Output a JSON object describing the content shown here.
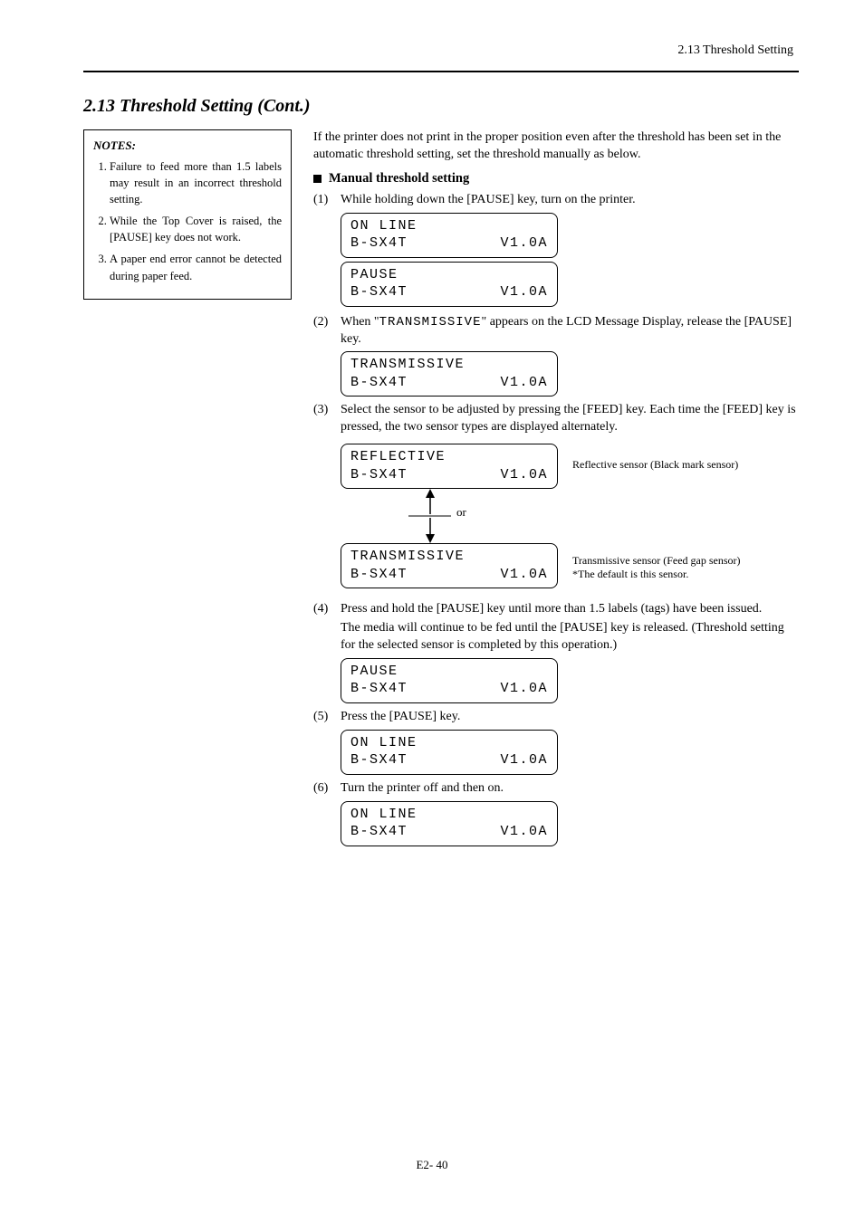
{
  "header": {
    "right": "2.13 Threshold Setting"
  },
  "section": {
    "number": "2.13",
    "title": "Threshold Setting (Cont.)"
  },
  "notes": {
    "heading": "NOTES:",
    "items": [
      "Failure to feed more than 1.5 labels may result in an incorrect threshold setting.",
      "While the Top Cover is raised, the [PAUSE] key does not work.",
      "A paper end error cannot be detected during paper feed."
    ]
  },
  "intro": "If the printer does not print in the proper position even after the threshold has been set in the automatic threshold setting, set the threshold manually as below.",
  "sub_heading": "Manual threshold setting",
  "steps": {
    "s1": "While holding down the [PAUSE] key, turn on the printer.",
    "s2": {
      "a": "When \"",
      "val": "TRANSMISSIVE",
      "b": "\" appears on the LCD Message Display, release the [PAUSE] key."
    },
    "s3": {
      "a": "Select the sensor to be adjusted by pressing the [FEED] key. ",
      "b": "Each time the [FEED] key is pressed, the two sensor types are displayed alternately."
    },
    "s3_ref": "Reflective sensor (Black mark sensor)",
    "s3_trn_note_a": "Transmissive sensor (Feed gap sensor)",
    "s3_trn_note_b": "*The default is this sensor.",
    "s4": "Press and hold the [PAUSE] key until more than 1.5 labels (tags) have been issued.",
    "s4b": "The media will continue to be fed until the [PAUSE] key is released. (Threshold setting for the selected sensor is completed by this operation.)",
    "s5": "Press the [PAUSE] key.",
    "s6": "Turn the printer off and then on."
  },
  "lcd": {
    "online": "ON LINE",
    "model": "B-SX4T",
    "version": "V1.0A",
    "pause": "PAUSE",
    "trans": "TRANSMISSIVE",
    "refl": "REFLECTIVE"
  },
  "or": "or",
  "pagenum": "E2- 40"
}
